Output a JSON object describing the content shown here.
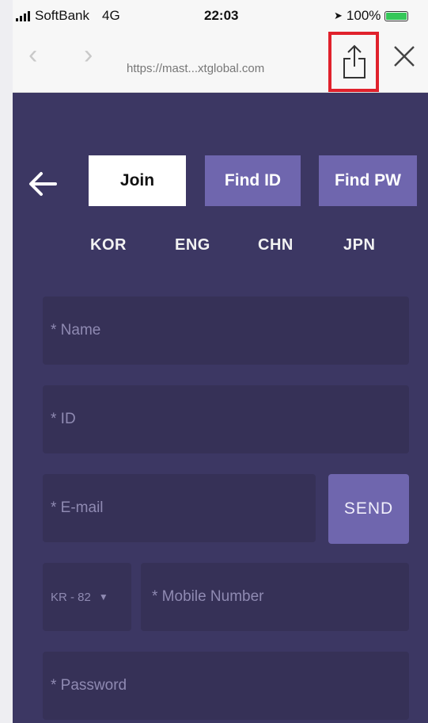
{
  "status_bar": {
    "carrier": "SoftBank",
    "network": "4G",
    "time": "22:03",
    "battery_text": "100%",
    "battery_level": 1.0
  },
  "browser": {
    "url": "https://mast...xtglobal.com",
    "back_icon": "chevron-left-icon",
    "forward_icon": "chevron-right-icon",
    "share_icon": "share-icon",
    "close_icon": "close-icon",
    "highlight_color": "#e0212c"
  },
  "tabs": [
    {
      "label": "Join",
      "active": true
    },
    {
      "label": "Find ID",
      "active": false
    },
    {
      "label": "Find PW",
      "active": false
    }
  ],
  "languages": [
    "KOR",
    "ENG",
    "CHN",
    "JPN"
  ],
  "form": {
    "name_placeholder": "* Name",
    "id_placeholder": "* ID",
    "email_placeholder": "* E-mail",
    "send_label": "SEND",
    "country_code": "KR - 82",
    "mobile_placeholder": "* Mobile Number",
    "password_placeholder": "* Password"
  },
  "colors": {
    "background": "#3c3763",
    "field": "#363157",
    "accent": "#6f66ae"
  }
}
